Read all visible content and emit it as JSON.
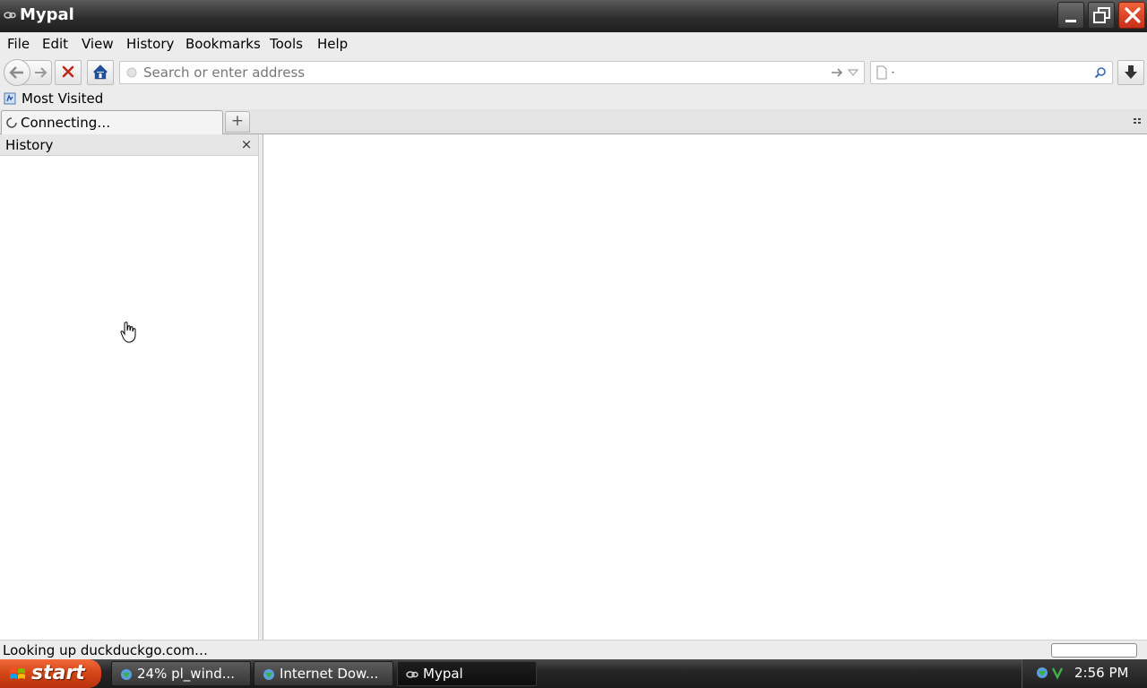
{
  "window": {
    "title": "Mypal",
    "controls": {
      "minimize_icon": "minimize-icon",
      "maximize_icon": "restore-icon",
      "close_icon": "close-icon"
    }
  },
  "menubar": {
    "items": [
      "File",
      "Edit",
      "View",
      "History",
      "Bookmarks",
      "Tools",
      "Help"
    ]
  },
  "navbar": {
    "address_placeholder": "Search or enter address",
    "address_value": "",
    "search_value": ""
  },
  "bookmarks": {
    "items": [
      {
        "label": "Most Visited",
        "icon": "bookmark-folder-icon"
      }
    ]
  },
  "tabs": [
    {
      "label": "Connecting…",
      "icon": "loading-spinner-icon",
      "active": true
    }
  ],
  "sidebar": {
    "title": "History",
    "close_label": "×"
  },
  "statusbar": {
    "text": "Looking up duckduckgo.com…"
  },
  "taskbar": {
    "start_label": "start",
    "tasks": [
      {
        "label": "24% pl_wind...",
        "icon": "download-globe-icon",
        "active": false
      },
      {
        "label": "Internet Dow...",
        "icon": "download-globe-icon",
        "active": false
      },
      {
        "label": "Mypal",
        "icon": "mypal-icon",
        "active": true
      }
    ],
    "clock": "2:56 PM"
  },
  "colors": {
    "chrome_bg": "#ececec",
    "titlebar": "#2e2e2e",
    "close_button": "#d9401f",
    "start_button": "#d24515",
    "home_icon": "#1f4e9a"
  }
}
